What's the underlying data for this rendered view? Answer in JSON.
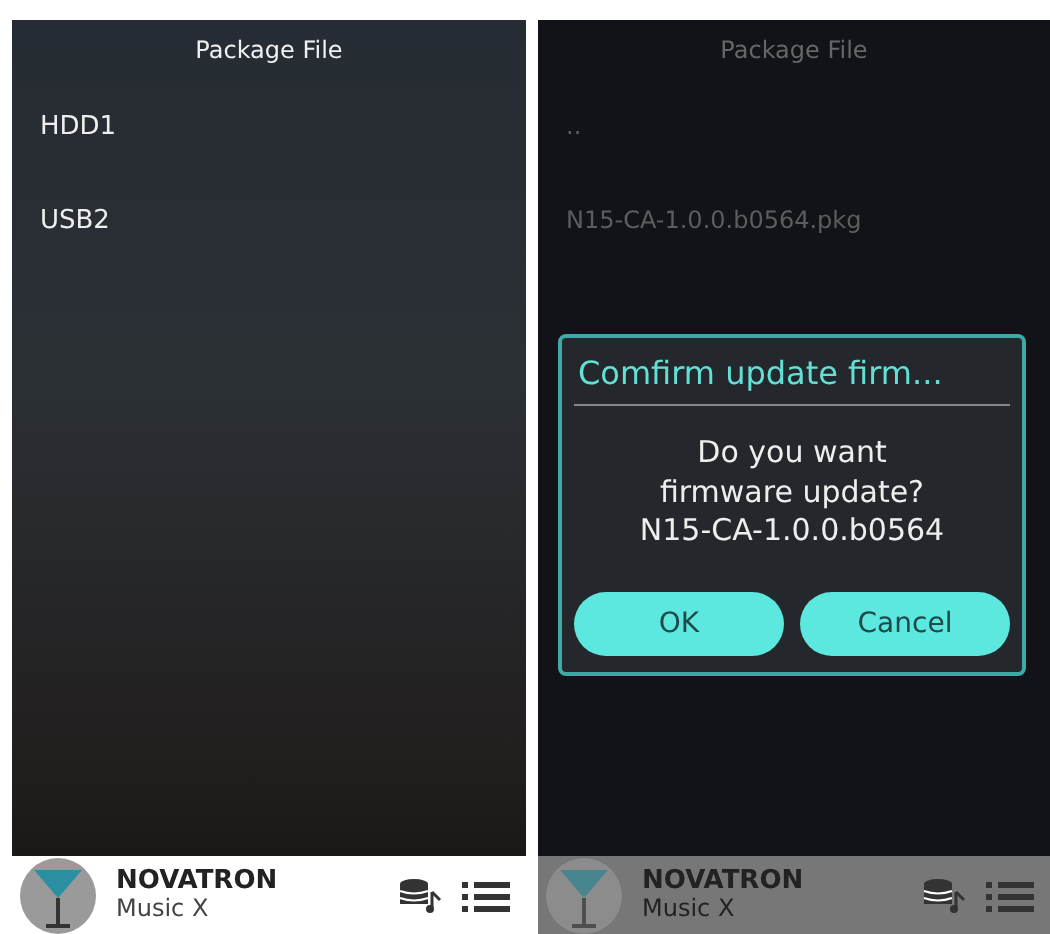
{
  "screens": [
    {
      "title": "Package File",
      "items": [
        "HDD1",
        "USB2"
      ],
      "dimmed": false,
      "player": {
        "title": "NOVATRON",
        "subtitle": "Music X"
      }
    },
    {
      "title": "Package File",
      "items": [
        "..",
        "N15-CA-1.0.0.b0564.pkg"
      ],
      "dimmed": true,
      "dialog": {
        "title": "Comfirm update firm...",
        "message": "Do you want firmware update? N15-CA-1.0.0.b0564",
        "buttons": [
          "OK",
          "Cancel"
        ]
      },
      "player": {
        "title": "NOVATRON",
        "subtitle": "Music X"
      }
    }
  ]
}
